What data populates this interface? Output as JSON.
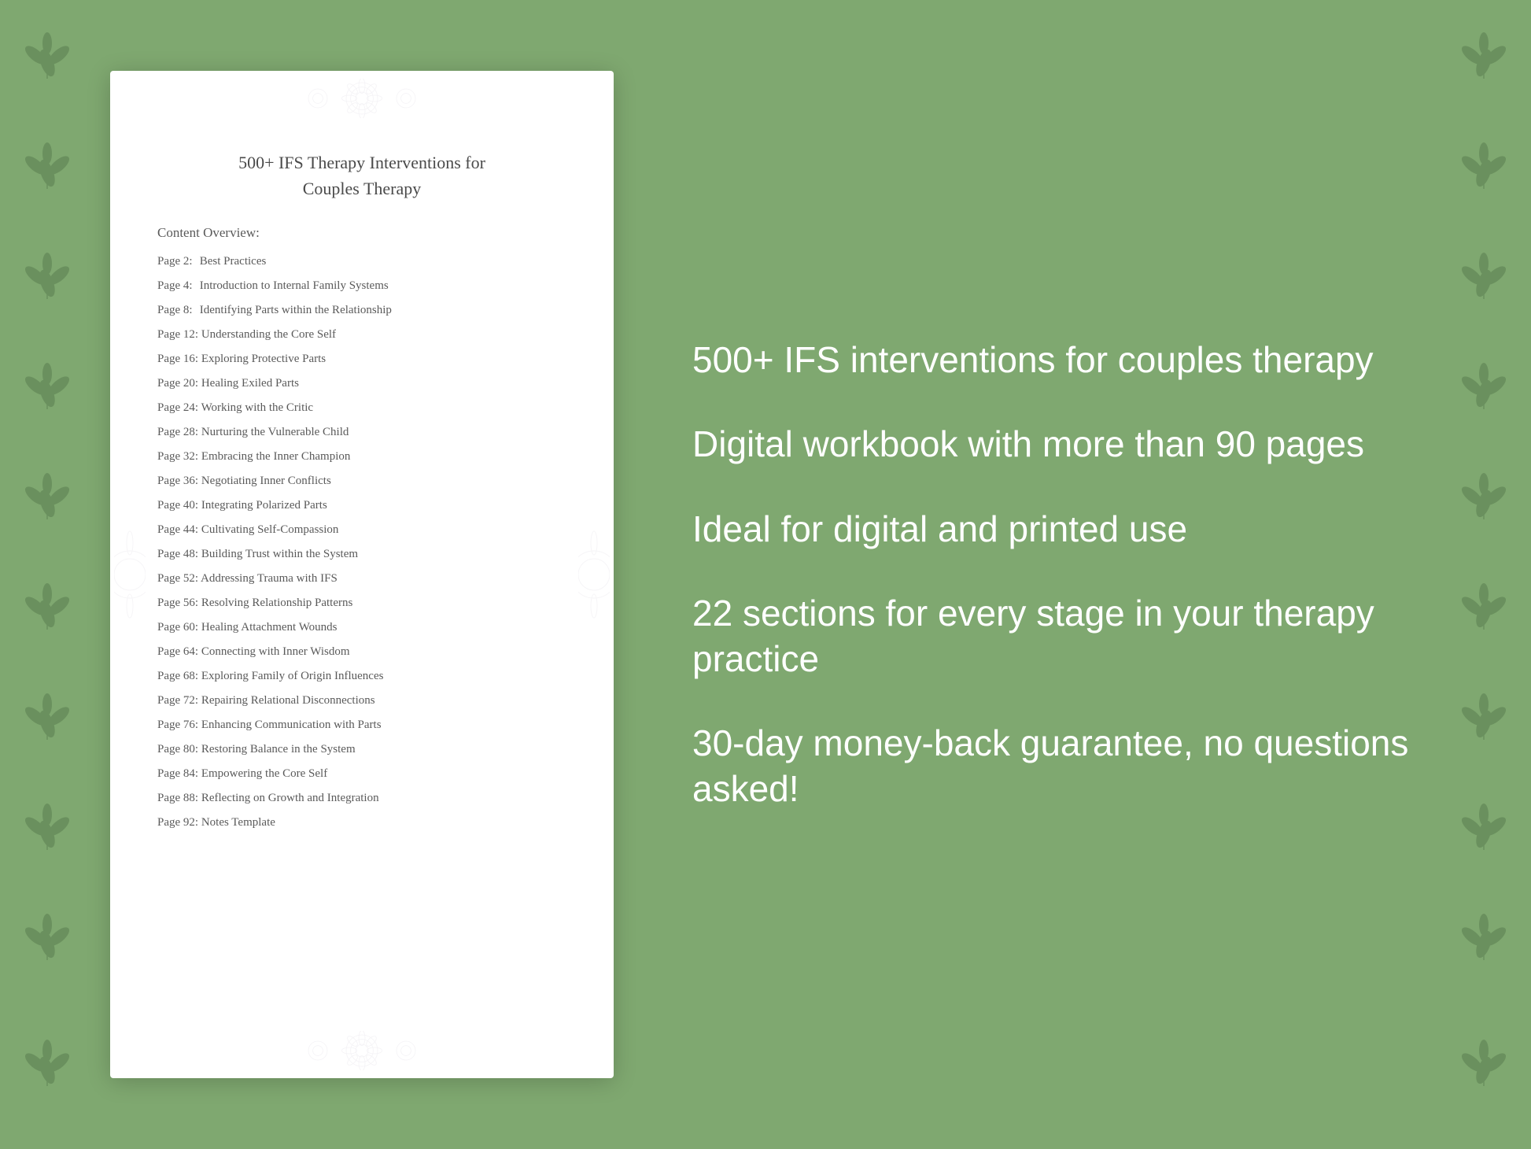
{
  "background": {
    "color": "#7fa870"
  },
  "document": {
    "title_line1": "500+ IFS Therapy Interventions for",
    "title_line2": "Couples Therapy",
    "content_overview_label": "Content Overview:",
    "toc": [
      {
        "page": "Page  2:",
        "title": "Best Practices"
      },
      {
        "page": "Page  4:",
        "title": "Introduction to Internal Family Systems"
      },
      {
        "page": "Page  8:",
        "title": "Identifying Parts within the Relationship"
      },
      {
        "page": "Page 12:",
        "title": "Understanding the Core Self"
      },
      {
        "page": "Page 16:",
        "title": "Exploring Protective Parts"
      },
      {
        "page": "Page 20:",
        "title": "Healing Exiled Parts"
      },
      {
        "page": "Page 24:",
        "title": "Working with the Critic"
      },
      {
        "page": "Page 28:",
        "title": "Nurturing the Vulnerable Child"
      },
      {
        "page": "Page 32:",
        "title": "Embracing the Inner Champion"
      },
      {
        "page": "Page 36:",
        "title": "Negotiating Inner Conflicts"
      },
      {
        "page": "Page 40:",
        "title": "Integrating Polarized Parts"
      },
      {
        "page": "Page 44:",
        "title": "Cultivating Self-Compassion"
      },
      {
        "page": "Page 48:",
        "title": "Building Trust within the System"
      },
      {
        "page": "Page 52:",
        "title": "Addressing Trauma with IFS"
      },
      {
        "page": "Page 56:",
        "title": "Resolving Relationship Patterns"
      },
      {
        "page": "Page 60:",
        "title": "Healing Attachment Wounds"
      },
      {
        "page": "Page 64:",
        "title": "Connecting with Inner Wisdom"
      },
      {
        "page": "Page 68:",
        "title": "Exploring Family of Origin Influences"
      },
      {
        "page": "Page 72:",
        "title": "Repairing Relational Disconnections"
      },
      {
        "page": "Page 76:",
        "title": "Enhancing Communication with Parts"
      },
      {
        "page": "Page 80:",
        "title": "Restoring Balance in the System"
      },
      {
        "page": "Page 84:",
        "title": "Empowering the Core Self"
      },
      {
        "page": "Page 88:",
        "title": "Reflecting on Growth and Integration"
      },
      {
        "page": "Page 92:",
        "title": "Notes Template"
      }
    ]
  },
  "features": [
    "500+ IFS interventions for couples therapy",
    "Digital workbook with more than 90 pages",
    "Ideal for digital and printed use",
    "22 sections for every stage in your therapy practice",
    "30-day money-back guarantee, no questions asked!"
  ]
}
